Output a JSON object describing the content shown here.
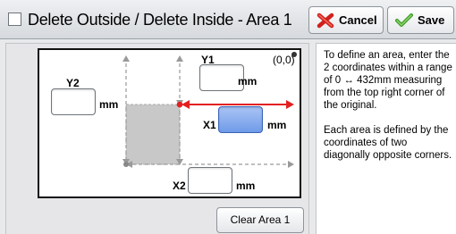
{
  "title": "Delete Outside / Delete Inside - Area 1",
  "buttons": {
    "cancel": "Cancel",
    "save": "Save",
    "clear_area": "Clear Area 1"
  },
  "fields": {
    "y1": {
      "label": "Y1",
      "value": "",
      "unit": "mm"
    },
    "y2": {
      "label": "Y2",
      "value": "",
      "unit": "mm"
    },
    "x1": {
      "label": "X1",
      "value": "",
      "unit": "mm"
    },
    "x2": {
      "label": "X2",
      "value": "",
      "unit": "mm"
    }
  },
  "origin_label": "(0,0)",
  "info": {
    "p1": "To define an area, enter the 2 coordinates within a range of 0 ↔ 432mm measuring from the top right corner of the original.",
    "p2": "Each area is defined by the coordinates of two diagonally opposite corners."
  },
  "colors": {
    "accent_arrow": "#e32020",
    "active_field": "#6f9be8",
    "selected_area": "#c8c8c8"
  },
  "icons": {
    "cancel": "red-x-icon",
    "save": "green-check-icon"
  }
}
